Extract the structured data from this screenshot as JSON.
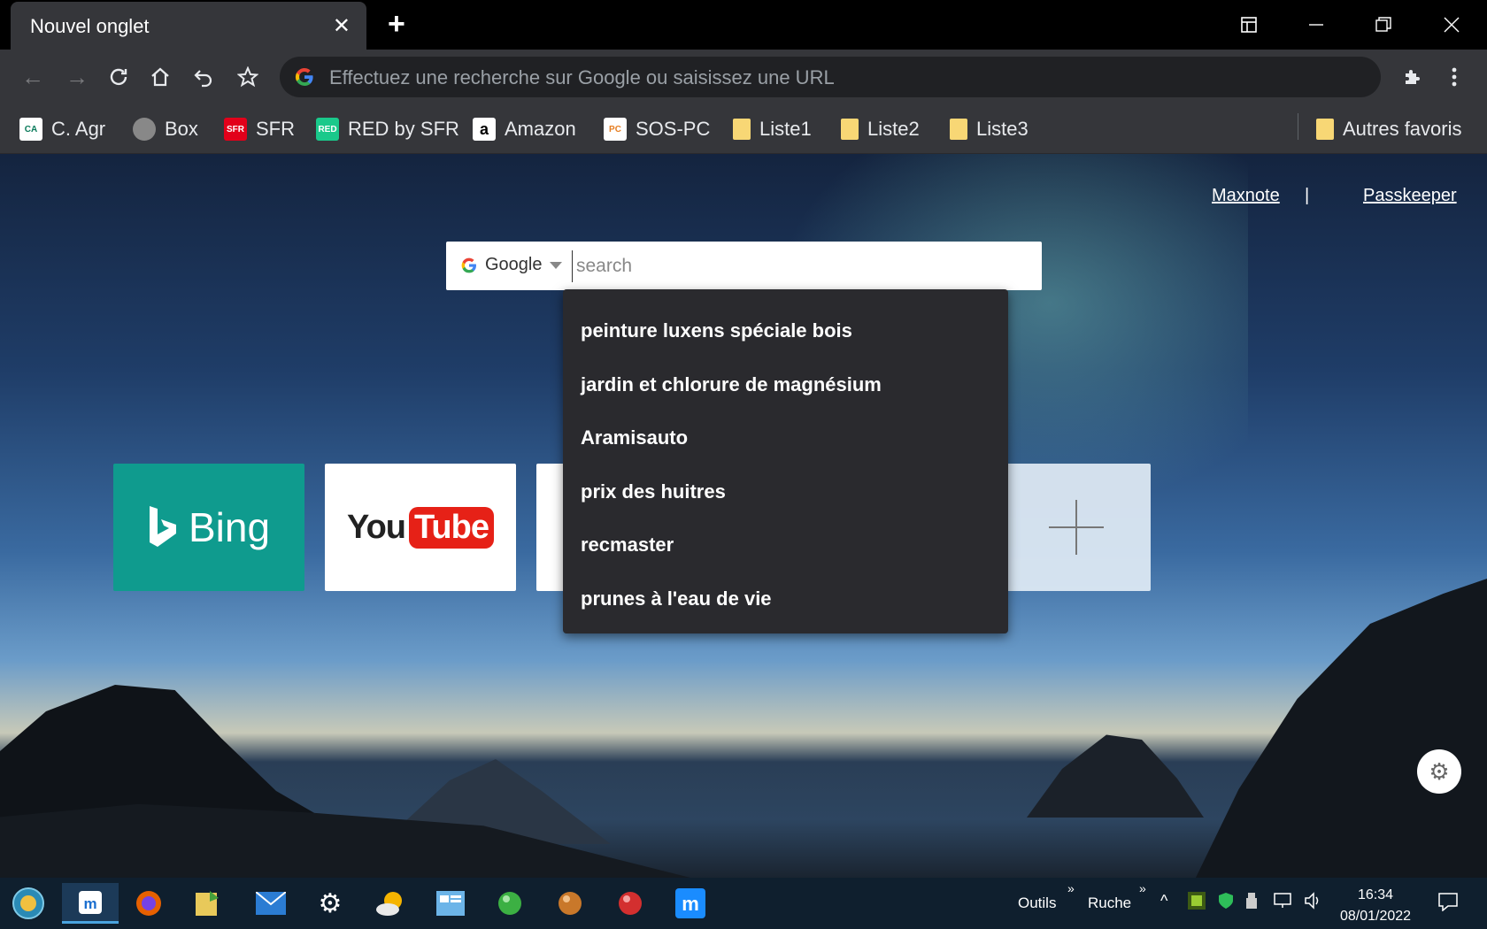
{
  "browser": {
    "tab_title": "Nouvel onglet",
    "omnibox_placeholder": "Effectuez une recherche sur Google ou saisissez une URL"
  },
  "bookmarks": [
    {
      "label": "C. Agr",
      "icon": "credit-agricole-icon"
    },
    {
      "label": "Box",
      "icon": "globe-icon"
    },
    {
      "label": "SFR",
      "icon": "sfr-icon"
    },
    {
      "label": "RED by SFR",
      "icon": "red-icon"
    },
    {
      "label": "Amazon",
      "icon": "amazon-icon"
    },
    {
      "label": "SOS-PC",
      "icon": "sos-pc-icon"
    },
    {
      "label": "Liste1",
      "icon": "folder-icon"
    },
    {
      "label": "Liste2",
      "icon": "folder-icon"
    },
    {
      "label": "Liste3",
      "icon": "folder-icon"
    }
  ],
  "other_bookmarks": "Autres favoris",
  "newtab": {
    "links": [
      "Maxnote",
      "Passkeeper"
    ],
    "separator": "|",
    "engine": "Google",
    "search_placeholder": "search",
    "suggestions": [
      "peinture luxens spéciale bois",
      "jardin et chlorure de magnésium",
      "Aramisauto",
      "prix des huitres",
      "recmaster",
      "prunes à l'eau de vie"
    ],
    "tiles": {
      "bing": "Bing",
      "youtube_you": "You",
      "youtube_tube": "Tube"
    }
  },
  "taskbar": {
    "outils": "Outils",
    "ruche": "Ruche",
    "time": "16:34",
    "date": "08/01/2022"
  },
  "colors": {
    "bing": "#0f9b8e",
    "youtube_red": "#e62117",
    "toolbar": "#35363a"
  }
}
